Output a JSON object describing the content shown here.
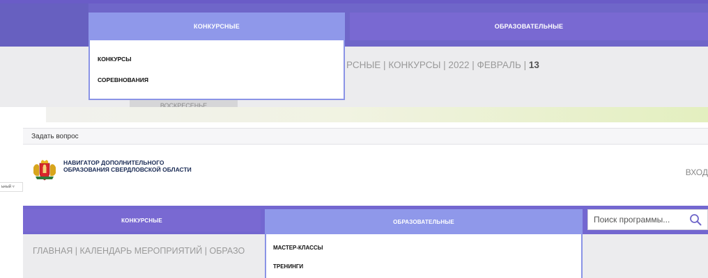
{
  "top": {
    "nav": {
      "tab_konkursnye": "КОНКУРСНЫЕ",
      "tab_obrazovatelnye": "ОБРАЗОВАТЕЛЬНЫЕ"
    },
    "dropdown": [
      "КОНКУРСЫ",
      "СОРЕВНОВАНИЯ"
    ],
    "breadcrumb_text": "РСНЫЕ  |  КОНКУРСЫ  |  2022  |  ФЕВРАЛЬ  |",
    "breadcrumb_current": "13",
    "day_header": "ВОСКРЕСЕНЬЕ"
  },
  "topbar": {
    "ask_link": "Задать вопрос"
  },
  "side_select": "ьный ▿",
  "header": {
    "brand": "НАВИГАТОР ДОПОЛНИТЕЛЬНОГО ОБРАЗОВАНИЯ СВЕРДЛОВСКОЙ ОБЛАСТИ",
    "login": "ВХОД"
  },
  "nav": {
    "tab_konkursnye": "КОНКУРСНЫЕ",
    "tab_obrazovatelnye": "ОБРАЗОВАТЕЛЬНЫЕ",
    "search_placeholder": "Поиск программы..."
  },
  "dropdown": [
    "МАСТЕР-КЛАССЫ",
    "ТРЕНИНГИ"
  ],
  "breadcrumb": "ГЛАВНАЯ  |  КАЛЕНДАРЬ МЕРОПРИЯТИЙ  |  ОБРАЗО",
  "colors": {
    "nav_purple": "#7367d0",
    "active_tab": "#8f98ea",
    "brand_text": "#1a2b55"
  }
}
